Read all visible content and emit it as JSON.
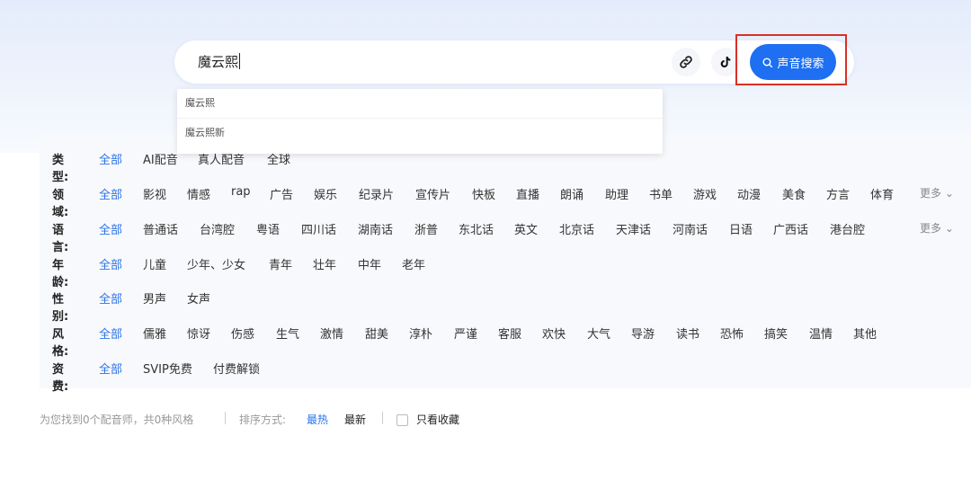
{
  "search": {
    "value": "魔云熙",
    "button_label": "声音搜索",
    "suggestions": [
      "魔云熙",
      "魔云熙新"
    ]
  },
  "icons": {
    "link": "link-icon",
    "tiktok": "tiktok-icon",
    "search": "search-icon",
    "more": "chevron-down-icon"
  },
  "filters": {
    "type": {
      "label": "类型:",
      "options": [
        "全部",
        "AI配音",
        "真人配音",
        "全球"
      ]
    },
    "field": {
      "label": "领域:",
      "options": [
        "全部",
        "影视",
        "情感",
        "rap",
        "广告",
        "娱乐",
        "纪录片",
        "宣传片",
        "快板",
        "直播",
        "朗诵",
        "助理",
        "书单",
        "游戏",
        "动漫",
        "美食",
        "方言",
        "体育"
      ],
      "more": "更多"
    },
    "language": {
      "label": "语言:",
      "options": [
        "全部",
        "普通话",
        "台湾腔",
        "粤语",
        "四川话",
        "湖南话",
        "浙普",
        "东北话",
        "英文",
        "北京话",
        "天津话",
        "河南话",
        "日语",
        "广西话",
        "港台腔"
      ],
      "more": "更多"
    },
    "age": {
      "label": "年龄:",
      "options": [
        "全部",
        "儿童",
        "少年、少女",
        "青年",
        "壮年",
        "中年",
        "老年"
      ]
    },
    "gender": {
      "label": "性别:",
      "options": [
        "全部",
        "男声",
        "女声"
      ]
    },
    "style": {
      "label": "风格:",
      "options": [
        "全部",
        "儒雅",
        "惊讶",
        "伤感",
        "生气",
        "激情",
        "甜美",
        "淳朴",
        "严谨",
        "客服",
        "欢快",
        "大气",
        "导游",
        "读书",
        "恐怖",
        "搞笑",
        "温情",
        "其他"
      ]
    },
    "fee": {
      "label": "资费:",
      "options": [
        "全部",
        "SVIP免费",
        "付费解锁"
      ]
    }
  },
  "results": {
    "summary": "为您找到0个配音师，共0种风格",
    "sort_label": "排序方式:",
    "sort_hot": "最热",
    "sort_new": "最新",
    "favorites_only": "只看收藏"
  },
  "colors": {
    "accent": "#2a74e8",
    "search_button": "#1e6ff1",
    "highlight_border": "#d93025"
  }
}
